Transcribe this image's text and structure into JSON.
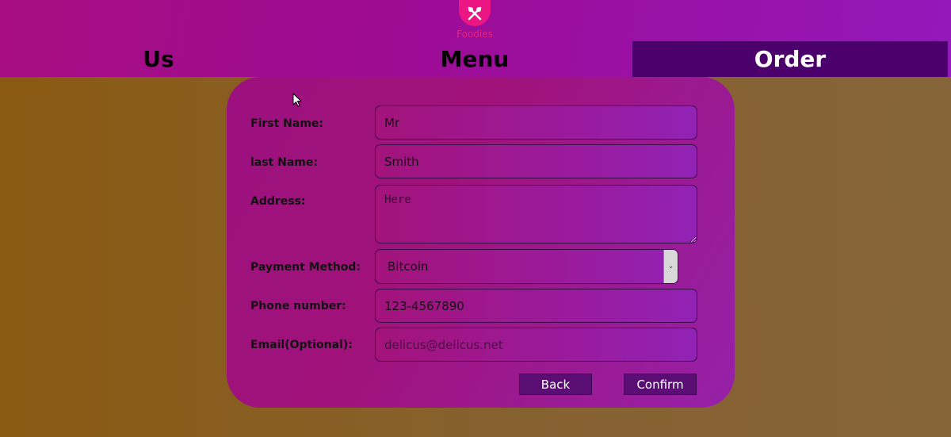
{
  "header": {
    "logo_text": "Foodies",
    "nav": {
      "us": "Us",
      "menu": "Menu",
      "order": "Order"
    }
  },
  "form": {
    "first_name": {
      "label": "First Name:",
      "value": "Mr"
    },
    "last_name": {
      "label": "last Name:",
      "value": "Smith"
    },
    "address": {
      "label": "Address:",
      "placeholder": "Here"
    },
    "payment": {
      "label": "Payment Method:",
      "value": "Bitcoin"
    },
    "phone": {
      "label": "Phone number:",
      "value": "123-4567890"
    },
    "email": {
      "label": "Email(Optional):",
      "placeholder": "delicus@delicus.net"
    }
  },
  "buttons": {
    "back": "Back",
    "confirm": "Confirm"
  },
  "icons": {
    "logo": "fork-knife-icon",
    "select_arrow": "chevron-down-icon",
    "cursor": "mouse-pointer-icon"
  },
  "colors": {
    "accent": "#ec1584",
    "active_nav": "#4b006b",
    "button": "#5a0d72"
  }
}
